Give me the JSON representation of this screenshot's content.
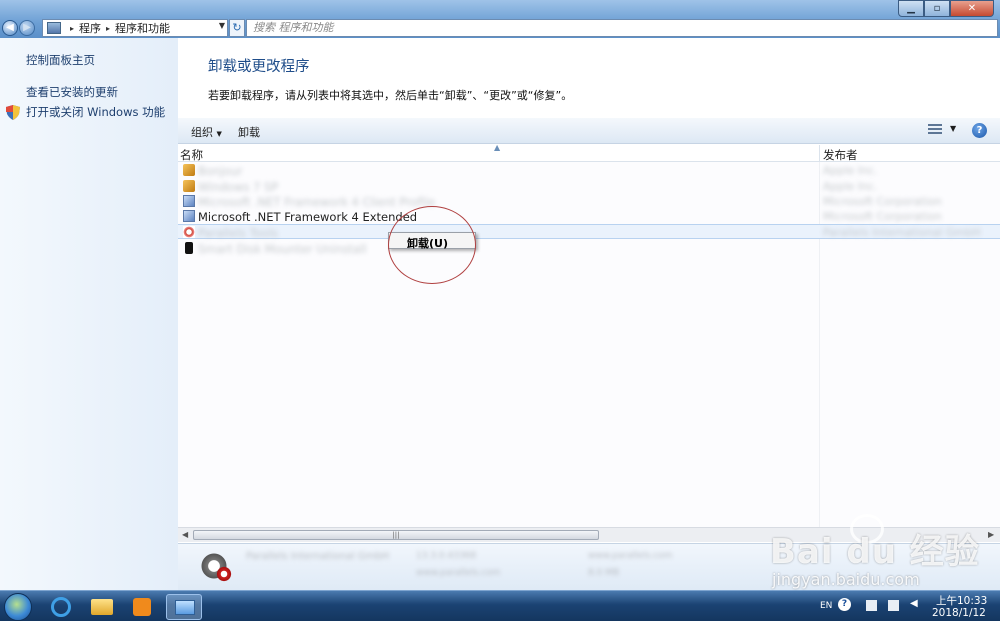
{
  "window": {
    "breadcrumb": [
      "程序",
      "程序和功能"
    ],
    "search_placeholder": "搜索 程序和功能",
    "controls": {
      "minimize": "▁",
      "maximize": "▫",
      "close": "✕"
    }
  },
  "leftpane": {
    "items": [
      {
        "label": "控制面板主页"
      },
      {
        "label": "查看已安装的更新"
      },
      {
        "label": "打开或关闭 Windows 功能",
        "icon": "shield-icon"
      }
    ]
  },
  "main": {
    "title": "卸载或更改程序",
    "description": "若要卸载程序，请从列表中将其选中，然后单击“卸载”、“更改”或“修复”。",
    "toolbar": {
      "organize": "组织",
      "uninstall": "卸载"
    },
    "columns": {
      "name": "名称",
      "publisher": "发布者"
    },
    "rows": [
      {
        "name": "Bonjour",
        "publisher": "Apple Inc.",
        "icon": "package-icon",
        "obscured": true
      },
      {
        "name": "Windows 7 SP",
        "publisher": "Apple Inc.",
        "icon": "package-icon",
        "obscured": true
      },
      {
        "name": "Microsoft .NET Framework 4 Client Profile",
        "publisher": "Microsoft Corporation",
        "icon": "dotnet-icon",
        "obscured": true
      },
      {
        "name": "Microsoft .NET Framework 4 Extended",
        "publisher": "Microsoft Corporation",
        "icon": "dotnet-icon",
        "obscured": false
      },
      {
        "name": "Parallels Tools",
        "publisher": "Parallels International GmbH",
        "icon": "parallels-icon",
        "obscured": true,
        "selected": true
      },
      {
        "name": "Smart Disk Mounter Uninstall",
        "publisher": "",
        "icon": "phone-icon",
        "obscured": true
      }
    ],
    "context_menu": {
      "uninstall": "卸载(U)"
    }
  },
  "details": {
    "publisher": "Parallels International GmbH",
    "version": "13.3.0.43368",
    "support_link": "www.parallels.com",
    "help_link": "www.parallels.com",
    "size": "8.0 MB"
  },
  "taskbar": {
    "language": "EN",
    "time": "上午10:33",
    "date": "2018/1/12"
  },
  "watermark": {
    "brand": "Bai du 经验",
    "url": "jingyan.baidu.com"
  }
}
